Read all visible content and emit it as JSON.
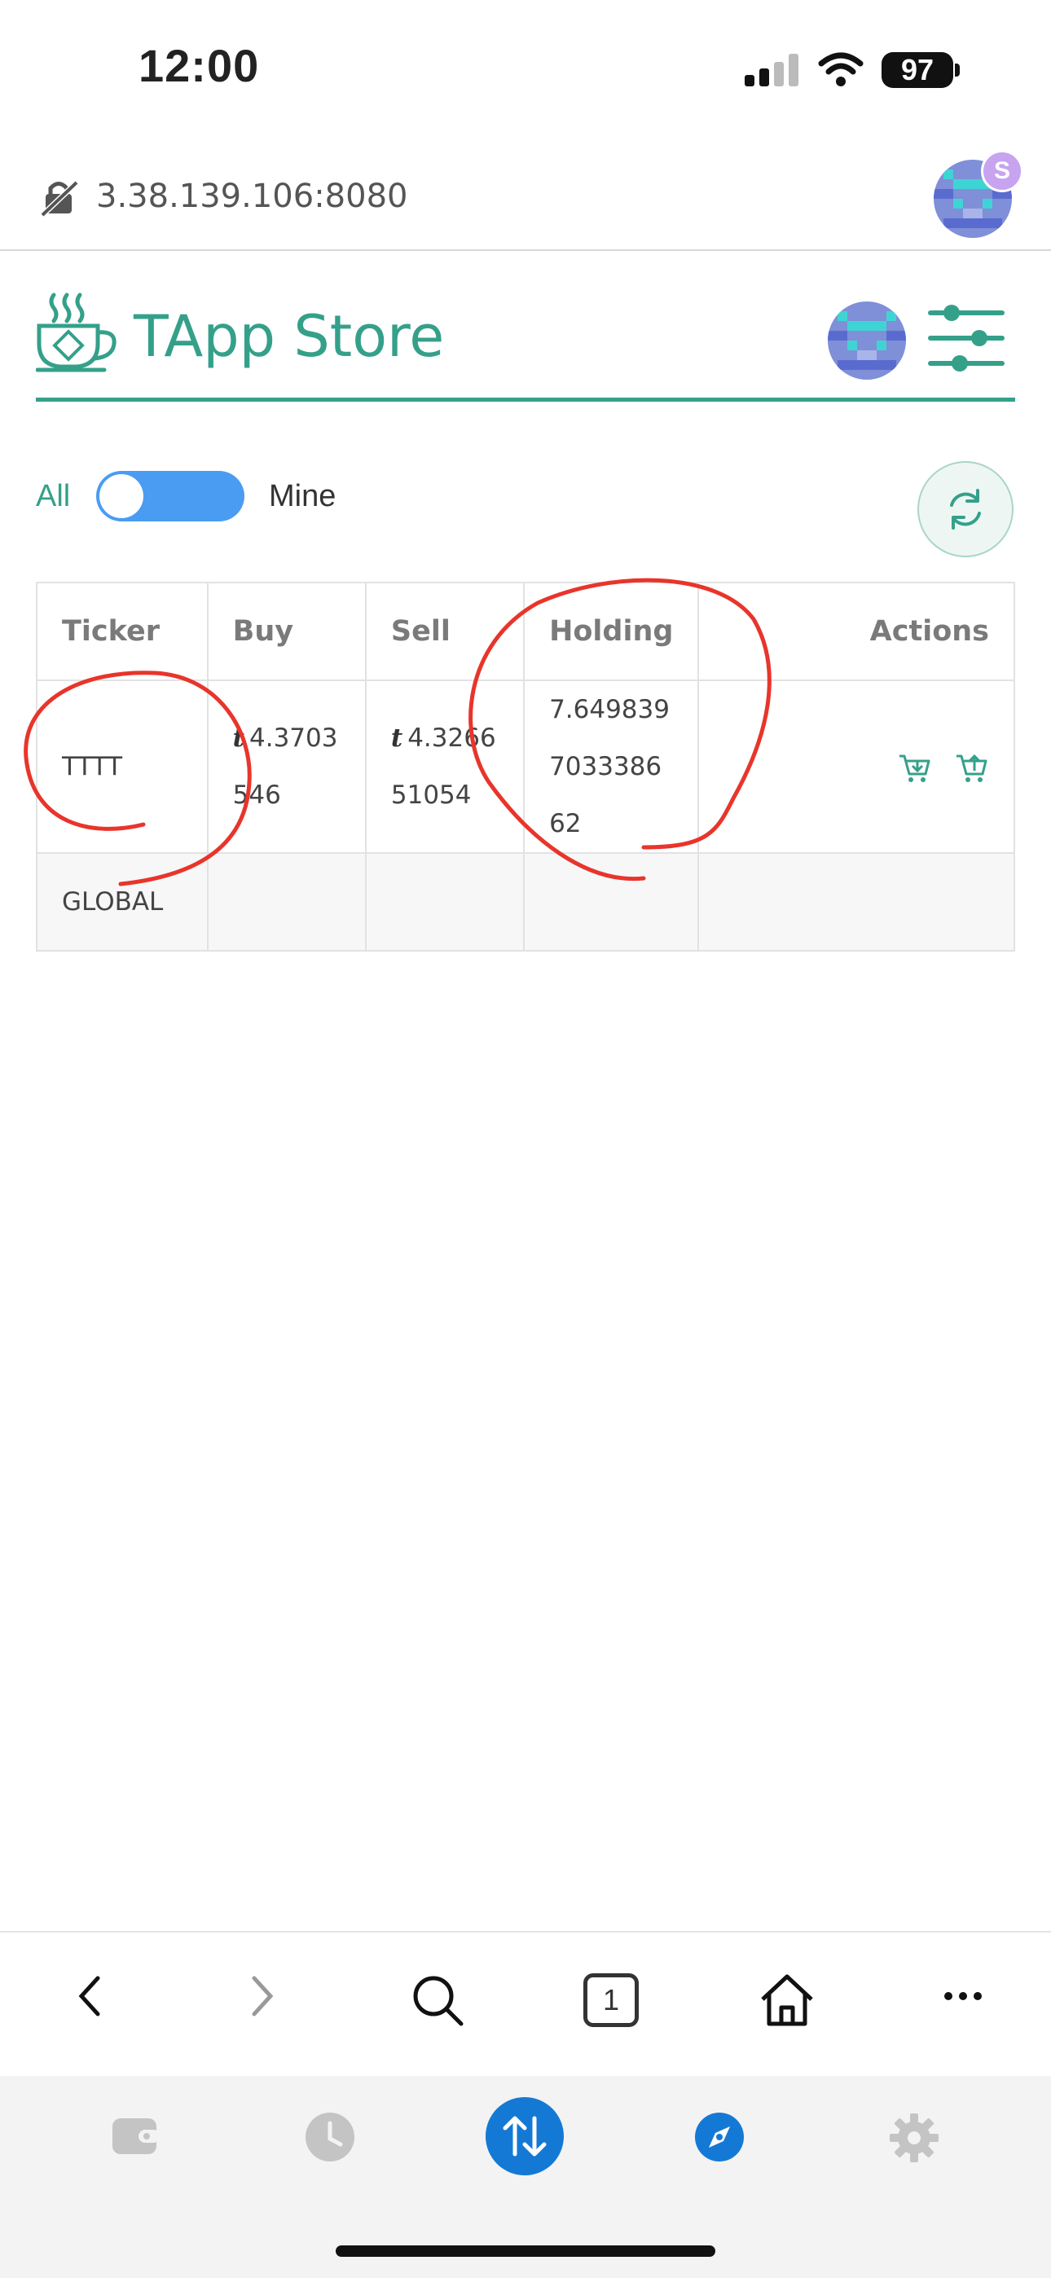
{
  "status_bar": {
    "time": "12:00",
    "battery": "97"
  },
  "browser": {
    "url": "3.38.139.106:8080",
    "profile_badge": "S",
    "tab_count": "1"
  },
  "app": {
    "title": "TApp Store",
    "accent_color": "#35a08a"
  },
  "filter": {
    "left_label": "All",
    "right_label": "Mine",
    "toggle_color": "#4a9cf2"
  },
  "table": {
    "headers": {
      "ticker": "Ticker",
      "buy": "Buy",
      "sell": "Sell",
      "holding": "Holding",
      "actions": "Actions"
    },
    "currency_symbol": "t",
    "rows": [
      {
        "ticker": "TTTT",
        "buy": "4.3703546",
        "sell": "4.326651054",
        "holding": "7.6498397033386 62"
      },
      {
        "ticker": "GLOBAL",
        "buy": "",
        "sell": "",
        "holding": ""
      }
    ]
  },
  "annotation_color": "#e8352b",
  "icons": {
    "url": "insecure-lock-icon",
    "logo": "tea-cup-logo-icon",
    "settings": "sliders-icon",
    "refresh": "refresh-icon",
    "buy": "cart-add-icon",
    "sell": "cart-remove-icon",
    "nav_back": "chevron-left-icon",
    "nav_forward": "chevron-right-icon",
    "search": "search-icon",
    "home": "home-icon",
    "more": "more-icon",
    "wallet": "wallet-icon",
    "history": "clock-icon",
    "swap": "swap-icon",
    "explore": "compass-icon",
    "settings_tab": "gear-icon"
  }
}
